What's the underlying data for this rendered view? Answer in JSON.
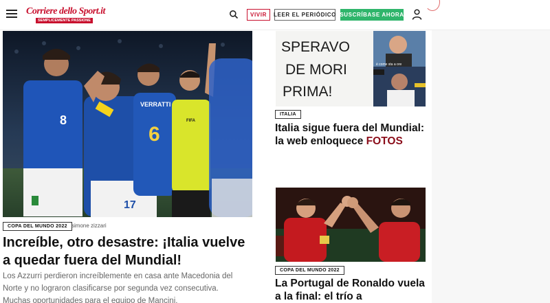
{
  "header": {
    "logo_text": "Corriere dello Sport.it",
    "logo_tagline": "SEMPLICEMENTE PASSIONE",
    "vivir_label": "VIVIR",
    "leer_label": "LEER EL PERIÓDICO",
    "subscribe_label": "SUSCRÍBASE AHORA",
    "icons": [
      "hamburger-icon",
      "search-icon",
      "user-icon"
    ]
  },
  "main_article": {
    "tag": "COPA DEL MUNDO 2022",
    "author": "simone zizzari",
    "title": "Increíble, otro desastre: ¡Italia vuelve a quedar fuera del Mundial!",
    "summary": "Los Azzurri perdieron increíblemente en casa ante Macedonia del Norte y no lograron clasificarse por segunda vez consecutiva. Muchas oportunidades para el equipo de Mancini,",
    "image_text": {
      "jersey_8": "8",
      "jersey_6": "6",
      "jersey_17": "17",
      "verratti": "VERRATTI",
      "fifa": "FIFA"
    }
  },
  "side_articles": [
    {
      "tag": "ITALIA",
      "title": "Italia sigue fuera del Mundial: la web enloquece",
      "highlight": "FOTOS",
      "image_text": {
        "banner_line_1": "SPERAVO",
        "banner_line_2": "DE MORI",
        "banner_line_3": "PRIMA!",
        "caption": "è come sta a ore"
      }
    },
    {
      "tag": "COPA DEL MUNDO 2022",
      "title": "La Portugal de Ronaldo vuela a la final: el trío a"
    }
  ],
  "colors": {
    "brand_red": "#c8102e",
    "subscribe_green": "#2fb56b",
    "fotos_red": "#8b0d1a",
    "summary_gray": "#666666"
  }
}
